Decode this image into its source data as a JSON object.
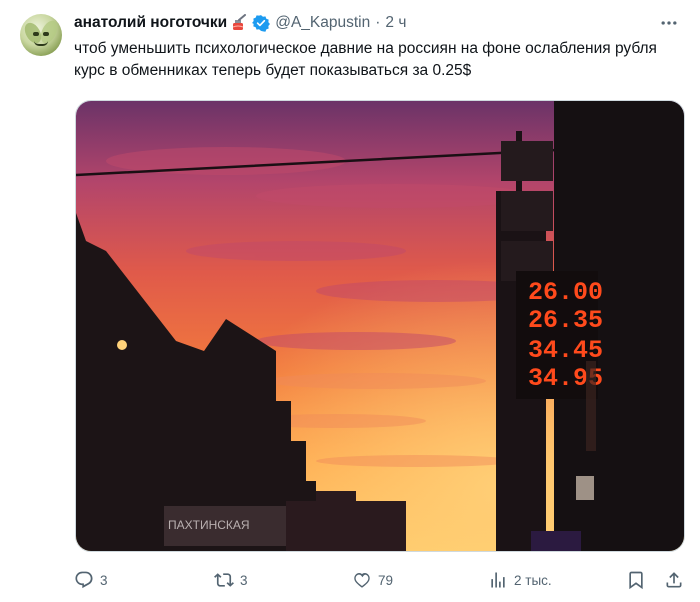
{
  "author": {
    "name": "анатолий ноготочки",
    "handle": "@A_Kapustin",
    "separator": "·",
    "time": "2 ч"
  },
  "tweet": {
    "text": "чтоб уменьшить психологическое давние на россиян на фоне ослабления рубля курс в обменниках теперь будет показываться за 0.25$"
  },
  "photo": {
    "board_rates": [
      "26.00",
      "26.35",
      "34.45",
      "34.95"
    ],
    "sign_text": "ПАХТИНСКАЯ",
    "accent_colors": {
      "sky_top": "#7a3a6e",
      "sky_mid": "#e8553f",
      "sky_glow": "#ffb347",
      "led": "#ff3b12"
    }
  },
  "actions": {
    "replies": "3",
    "retweets": "3",
    "likes": "79",
    "views": "2 тыс.",
    "icons": [
      "reply-icon",
      "retweet-icon",
      "like-icon",
      "views-icon",
      "bookmark-icon",
      "share-icon"
    ]
  },
  "colors": {
    "text": "#0f1419",
    "secondary": "#536471",
    "verified": "#1d9bf0"
  }
}
